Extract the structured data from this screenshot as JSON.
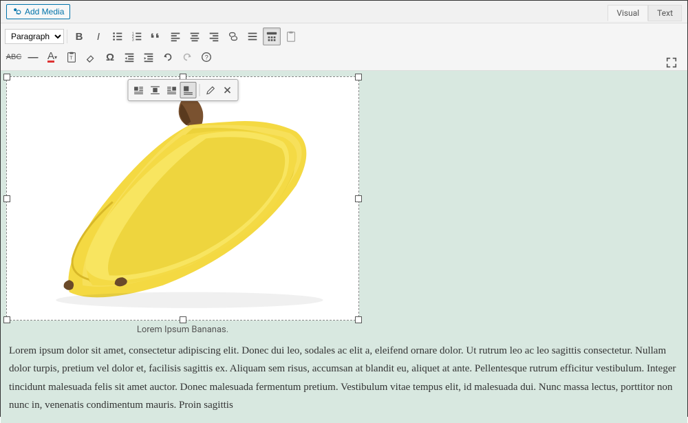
{
  "header": {
    "add_media": "Add Media",
    "tabs": {
      "visual": "Visual",
      "text": "Text"
    }
  },
  "toolbar": {
    "format_select": "Paragraph"
  },
  "image": {
    "caption": "Lorem Ipsum Bananas.",
    "alt": "Bananas"
  },
  "content": {
    "paragraph": "Lorem ipsum dolor sit amet, consectetur adipiscing elit. Donec dui leo, sodales ac elit a, eleifend ornare dolor. Ut rutrum leo ac leo sagittis consectetur. Nullam dolor turpis, pretium vel dolor et, facilisis sagittis ex. Aliquam sem risus, accumsan at blandit eu, aliquet at ante. Pellentesque rutrum efficitur vestibulum. Integer tincidunt malesuada felis sit amet auctor. Donec malesuada fermentum pretium. Vestibulum vitae tempus elit, id malesuada dui. Nunc massa lectus, porttitor non nunc in, venenatis condimentum mauris. Proin sagittis"
  }
}
